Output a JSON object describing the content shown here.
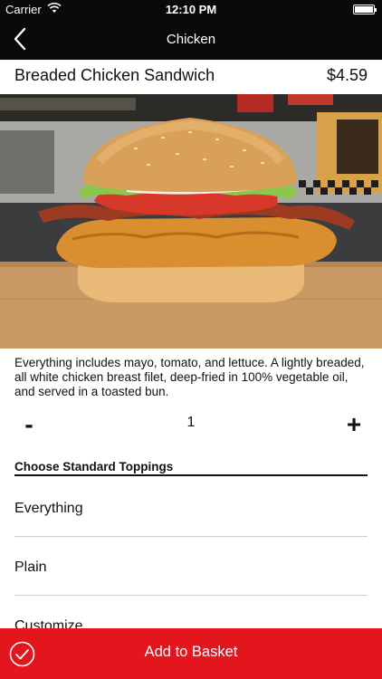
{
  "status_bar": {
    "carrier": "Carrier",
    "time": "12:10 PM",
    "battery_level": 1.0
  },
  "nav": {
    "title": "Chicken",
    "back_icon": "chevron-left-icon"
  },
  "product": {
    "name": "Breaded Chicken Sandwich",
    "price": "$4.59",
    "image": "chicken-sandwich-photo",
    "description": "Everything includes mayo, tomato, and lettuce. A lightly breaded, all white chicken breast filet, deep-fried in 100% vegetable oil, and served in a toasted bun."
  },
  "quantity": {
    "minus_label": "-",
    "value": "1",
    "plus_label": "+"
  },
  "toppings": {
    "header": "Choose Standard Toppings",
    "options": [
      {
        "label": "Everything"
      },
      {
        "label": "Plain"
      },
      {
        "label": "Customize"
      }
    ]
  },
  "footer": {
    "add_label": "Add to Basket",
    "check_icon": "check-circle-icon"
  },
  "colors": {
    "brand_red": "#e3151d",
    "nav_bg": "#0a0a0a"
  }
}
